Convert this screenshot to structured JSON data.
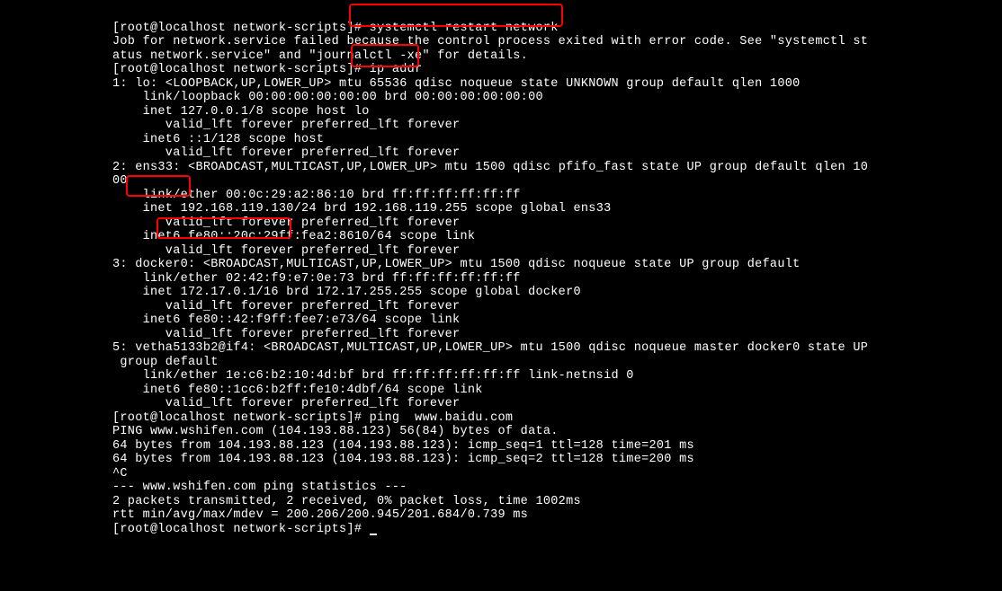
{
  "prompt1": "[root@localhost network-scripts]# ",
  "cmd1": "systemctl restart network",
  "job_err1": "Job for network.service failed because the control process exited with error code. See \"systemctl st",
  "job_err2": "atus network.service\" and \"journalctl -xe\" for details.",
  "prompt2": "[root@localhost network-scripts]# ",
  "cmd2": "ip addr",
  "iface1_header": "1: lo: <LOOPBACK,UP,LOWER_UP> mtu 65536 qdisc noqueue state UNKNOWN group default qlen 1000",
  "iface1_link": "    link/loopback 00:00:00:00:00:00 brd 00:00:00:00:00:00",
  "iface1_inet": "    inet 127.0.0.1/8 scope host lo",
  "iface1_valid": "       valid_lft forever preferred_lft forever",
  "iface1_inet6": "    inet6 ::1/128 scope host ",
  "iface1_valid2": "       valid_lft forever preferred_lft forever",
  "iface2_pre": "2: ",
  "iface2_name": "ens33:",
  "iface2_post": " <BROADCAST,MULTICAST,UP,LOWER_UP> mtu 1500 qdisc pfifo_fast state UP group default qlen 10",
  "iface2_header_wrap": "00",
  "iface2_link": "    link/ether 00:0c:29:a2:86:10 brd ff:ff:ff:ff:ff:ff",
  "iface2_inet_pre": "    inet ",
  "iface2_ip": "192.168.119.130",
  "iface2_inet_post": "/24 brd 192.168.119.255 scope global ens33",
  "iface2_valid": "       valid_lft forever preferred_lft forever",
  "iface2_inet6": "    inet6 fe80::20c:29ff:fea2:8610/64 scope link ",
  "iface2_valid2": "       valid_lft forever preferred_lft forever",
  "iface3_header": "3: docker0: <BROADCAST,MULTICAST,UP,LOWER_UP> mtu 1500 qdisc noqueue state UP group default ",
  "iface3_link": "    link/ether 02:42:f9:e7:0e:73 brd ff:ff:ff:ff:ff:ff",
  "iface3_inet": "    inet 172.17.0.1/16 brd 172.17.255.255 scope global docker0",
  "iface3_valid": "       valid_lft forever preferred_lft forever",
  "iface3_inet6": "    inet6 fe80::42:f9ff:fee7:e73/64 scope link ",
  "iface3_valid2": "       valid_lft forever preferred_lft forever",
  "iface5_header": "5: vetha5133b2@if4: <BROADCAST,MULTICAST,UP,LOWER_UP> mtu 1500 qdisc noqueue master docker0 state UP",
  "iface5_header2": " group default ",
  "iface5_link": "    link/ether 1e:c6:b2:10:4d:bf brd ff:ff:ff:ff:ff:ff link-netnsid 0",
  "iface5_inet6": "    inet6 fe80::1cc6:b2ff:fe10:4dbf/64 scope link ",
  "iface5_valid": "       valid_lft forever preferred_lft forever",
  "prompt3": "[root@localhost network-scripts]# ",
  "cmd3": "ping  www.baidu.com",
  "ping_header": "PING www.wshifen.com (104.193.88.123) 56(84) bytes of data.",
  "ping_reply1": "64 bytes from 104.193.88.123 (104.193.88.123): icmp_seq=1 ttl=128 time=201 ms",
  "ping_reply2": "64 bytes from 104.193.88.123 (104.193.88.123): icmp_seq=2 ttl=128 time=200 ms",
  "ping_ctrlc": "^C",
  "ping_stats_hdr": "--- www.wshifen.com ping statistics ---",
  "ping_stats1": "2 packets transmitted, 2 received, 0% packet loss, time 1002ms",
  "ping_stats2": "rtt min/avg/max/mdev = 200.206/200.945/201.684/0.739 ms",
  "prompt4": "[root@localhost network-scripts]# "
}
